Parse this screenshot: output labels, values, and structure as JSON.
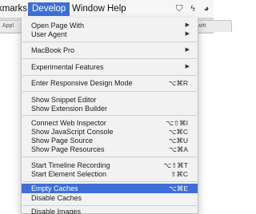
{
  "menubar": {
    "bookmarks_label": "kmarks",
    "develop_label": "Develop",
    "window_label": "Window",
    "help_label": "Help",
    "tray": [
      {
        "icon": "shield-icon",
        "glyph": "⛉"
      },
      {
        "icon": "lightning-icon",
        "glyph": "ϟ"
      },
      {
        "icon": "status-circle-icon",
        "glyph": "◕"
      }
    ]
  },
  "background": {
    "tab_left": "Appl",
    "tab_right": "Twitt"
  },
  "develop_menu": {
    "items": [
      {
        "label": "Open Page With",
        "shortcut": "",
        "submenu": true
      },
      {
        "label": "User Agent",
        "shortcut": "",
        "submenu": true
      },
      {
        "label": "MacBook Pro",
        "shortcut": "",
        "submenu": true
      },
      {
        "label": "Experimental Features",
        "shortcut": "",
        "submenu": true
      },
      {
        "label": "Enter Responsive Design Mode",
        "shortcut": "⌥⌘R",
        "submenu": false
      },
      {
        "label": "Show Snippet Editor",
        "shortcut": "",
        "submenu": false
      },
      {
        "label": "Show Extension Builder",
        "shortcut": "",
        "submenu": false
      },
      {
        "label": "Connect Web Inspector",
        "shortcut": "⌥⇧⌘I",
        "submenu": false
      },
      {
        "label": "Show JavaScript Console",
        "shortcut": "⌥⌘C",
        "submenu": false
      },
      {
        "label": "Show Page Source",
        "shortcut": "⌥⌘U",
        "submenu": false
      },
      {
        "label": "Show Page Resources",
        "shortcut": "⌥⌘A",
        "submenu": false
      },
      {
        "label": "Start Timeline Recording",
        "shortcut": "⌥⇧⌘T",
        "submenu": false
      },
      {
        "label": "Start Element Selection",
        "shortcut": "⇧⌘C",
        "submenu": false
      },
      {
        "label": "Empty Caches",
        "shortcut": "⌥⌘E",
        "submenu": false,
        "highlighted": true
      },
      {
        "label": "Disable Caches",
        "shortcut": "",
        "submenu": false
      },
      {
        "label": "Disable Images",
        "shortcut": "",
        "submenu": false
      }
    ]
  },
  "colors": {
    "accent": "#3d6fd6",
    "menu_bg": "#f2f2f2",
    "separator": "#cfcfcf"
  }
}
